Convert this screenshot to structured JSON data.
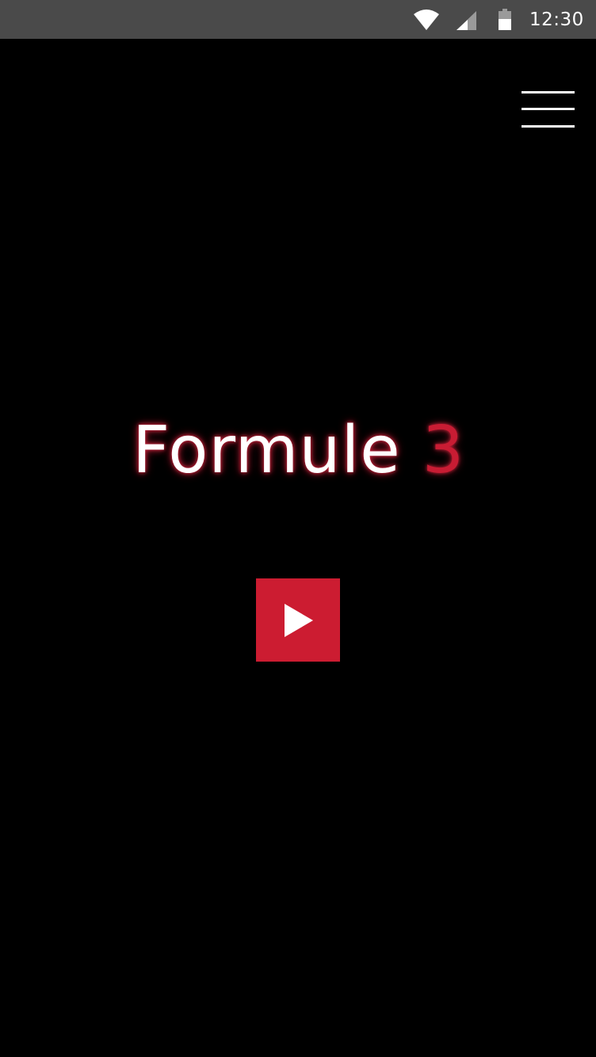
{
  "status_bar": {
    "time": "12:30",
    "icons": [
      "wifi-icon",
      "signal-icon",
      "battery-icon"
    ],
    "background": "#4a4a4a"
  },
  "header": {
    "menu_icon": "hamburger-menu-icon"
  },
  "hero": {
    "logo_word": "Formule",
    "logo_number": "3",
    "logo_word_color": "#ffffff",
    "logo_number_color": "#c81c33",
    "glow_color": "#c8203a"
  },
  "play_button": {
    "icon": "play-icon",
    "color": "#cc1c31"
  },
  "app_background": "#000000"
}
